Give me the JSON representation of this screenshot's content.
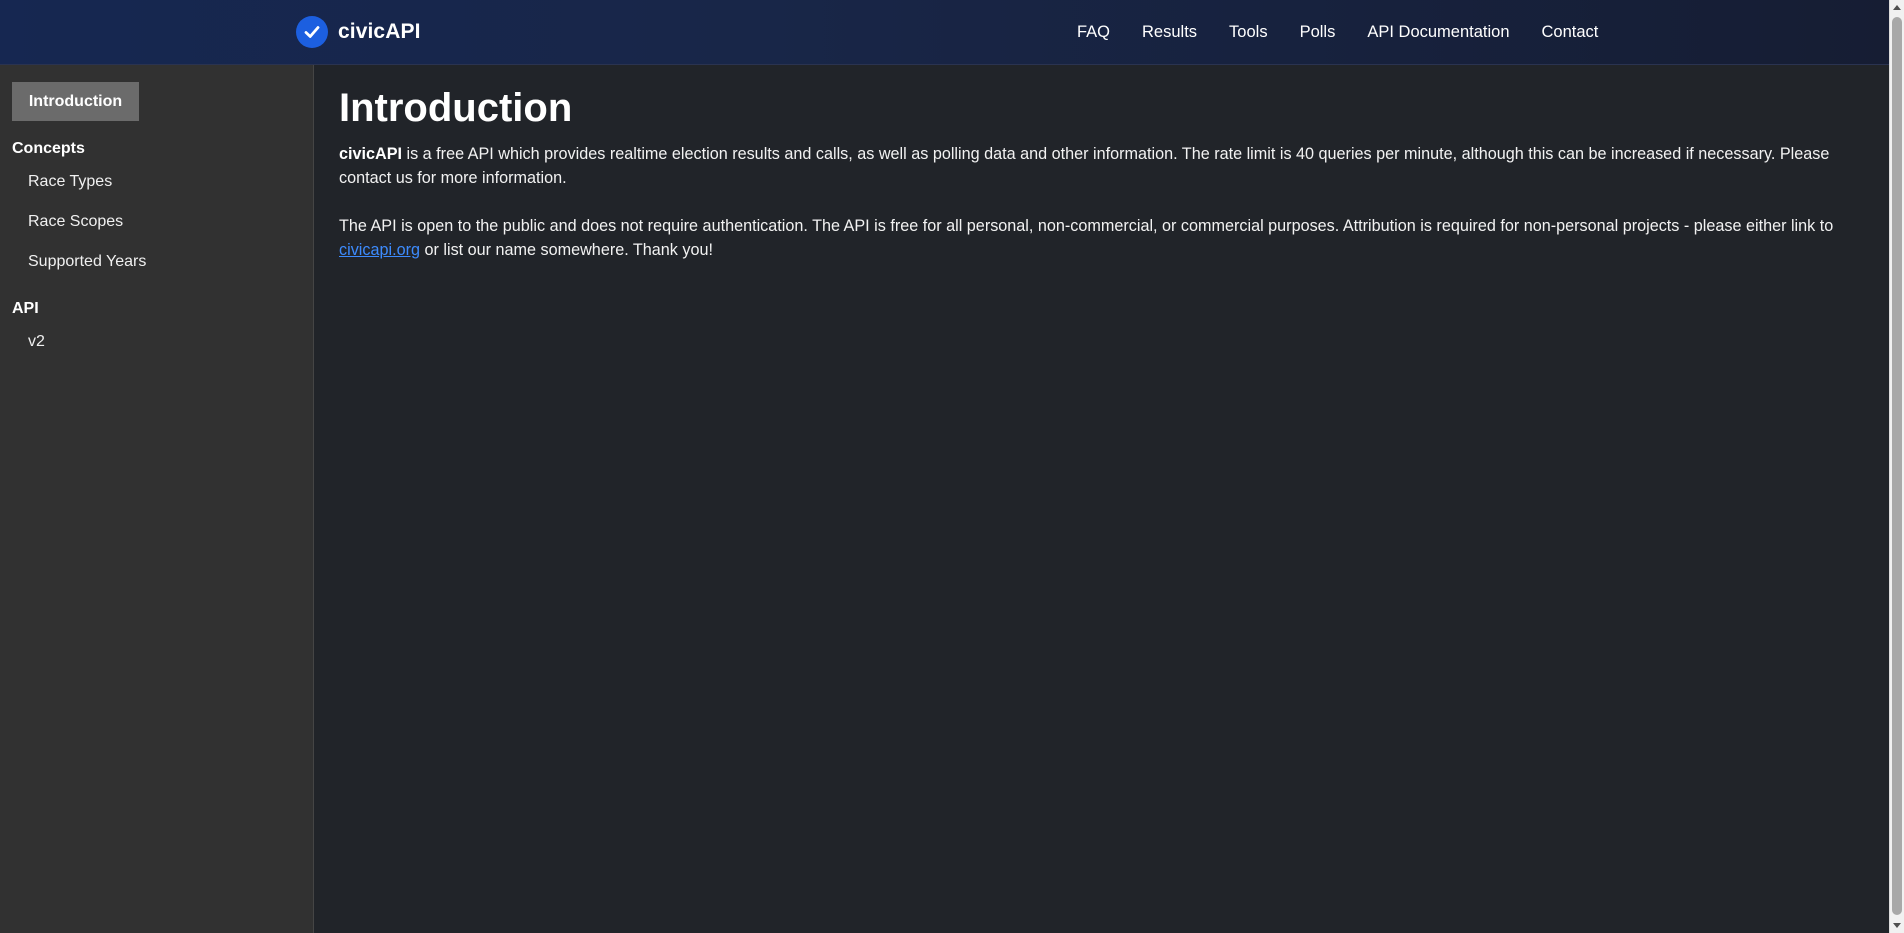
{
  "brand": {
    "name": "civicAPI",
    "logo_icon": "check-circle-icon",
    "logo_color": "#1c5fe0"
  },
  "nav": {
    "items": [
      "FAQ",
      "Results",
      "Tools",
      "Polls",
      "API Documentation",
      "Contact"
    ]
  },
  "sidebar": {
    "active_item": "Introduction",
    "sections": [
      {
        "heading": "Concepts",
        "items": [
          "Race Types",
          "Race Scopes",
          "Supported Years"
        ]
      },
      {
        "heading": "API",
        "items": [
          "v2"
        ]
      }
    ]
  },
  "main": {
    "title": "Introduction",
    "p1_bold": "civicAPI",
    "p1_rest": " is a free API which provides realtime election results and calls, as well as polling data and other information. The rate limit is 40 queries per minute, although this can be increased if necessary. Please contact us for more information.",
    "p2_start": "The API is open to the public and does not require authentication. The API is free for all personal, non-commercial, or commercial purposes. Attribution is required for non-personal projects - please either link to ",
    "p2_link": "civicapi.org",
    "p2_end": " or list our name somewhere. Thank you!"
  },
  "colors": {
    "page_bg": "#212429",
    "sidebar_bg": "#313131",
    "sidebar_active_bg": "#6b6b6b",
    "navbar_bg": "#182648",
    "link": "#3d8bfd"
  }
}
